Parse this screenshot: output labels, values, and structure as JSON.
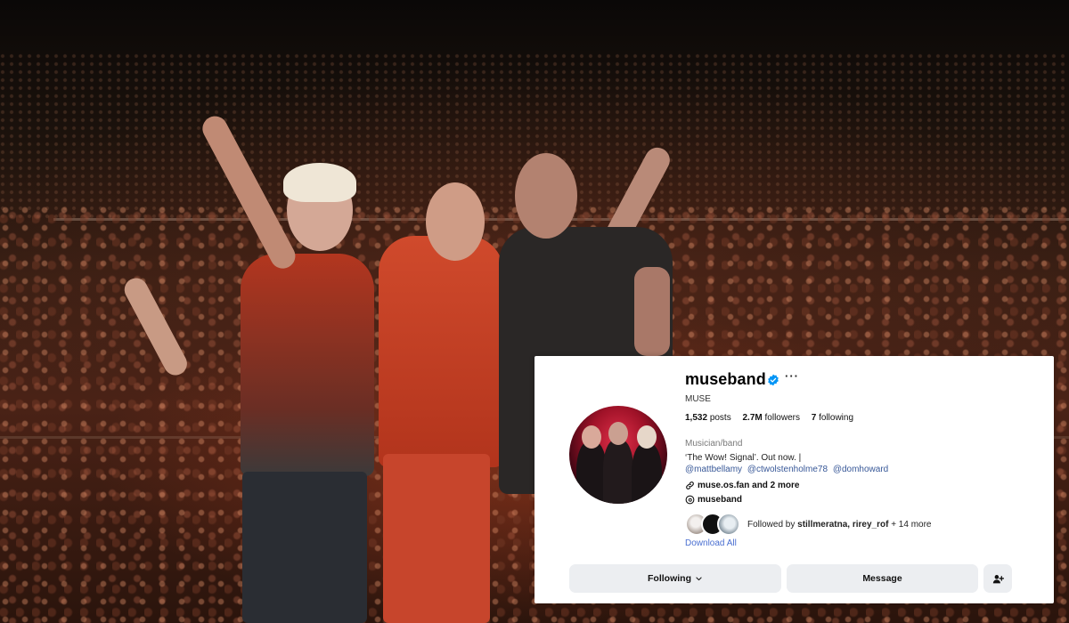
{
  "profile": {
    "username": "museband",
    "more_label": "···",
    "full_name": "MUSE",
    "stats": {
      "posts_count": "1,532",
      "posts_label": "posts",
      "followers_count": "2.7M",
      "followers_label": "followers",
      "following_count": "7",
      "following_label": "following"
    },
    "category": "Musician/band",
    "bio": "‘The Wow! Signal’. Out now. |",
    "mentions": [
      "@mattbellamy",
      "@ctwolstenholme78",
      "@domhoward"
    ],
    "link_text": "muse.os.fan and 2 more",
    "threads_handle": "museband",
    "followed_by_prefix": "Followed by",
    "followed_by_names": "stillmeratna, rirey_rof",
    "followed_by_suffix": "+ 14 more",
    "download_label": "Download All"
  },
  "buttons": {
    "following_label": "Following",
    "message_label": "Message"
  },
  "icons": {
    "verified": "verified-badge-icon",
    "link": "link-icon",
    "threads": "threads-icon",
    "chevron": "chevron-down-icon",
    "add_user": "add-user-icon"
  },
  "colors": {
    "verified_blue": "#0095f6",
    "mention_blue": "#385898",
    "download_blue": "#4a6fd1",
    "button_bg": "#eceef1"
  }
}
